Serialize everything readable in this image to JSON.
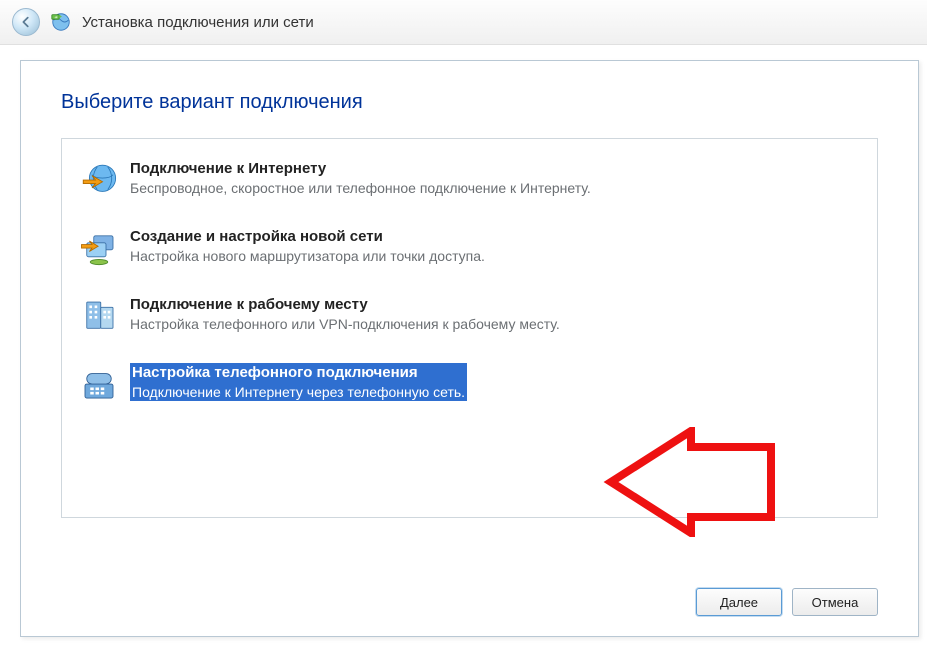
{
  "window": {
    "title": "Установка подключения или сети"
  },
  "page": {
    "heading": "Выберите вариант подключения"
  },
  "options": [
    {
      "icon": "globe-internet-icon",
      "title": "Подключение к Интернету",
      "desc": "Беспроводное, скоростное или телефонное подключение к Интернету."
    },
    {
      "icon": "router-icon",
      "title": "Создание и настройка новой сети",
      "desc": "Настройка нового маршрутизатора или точки доступа."
    },
    {
      "icon": "workplace-icon",
      "title": "Подключение к рабочему месту",
      "desc": "Настройка телефонного или VPN-подключения к рабочему месту."
    },
    {
      "icon": "dialup-phone-icon",
      "title": "Настройка телефонного подключения",
      "desc": "Подключение к Интернету через телефонную сеть."
    }
  ],
  "selected_index": 3,
  "footer": {
    "next": "Далее",
    "cancel": "Отмена"
  }
}
